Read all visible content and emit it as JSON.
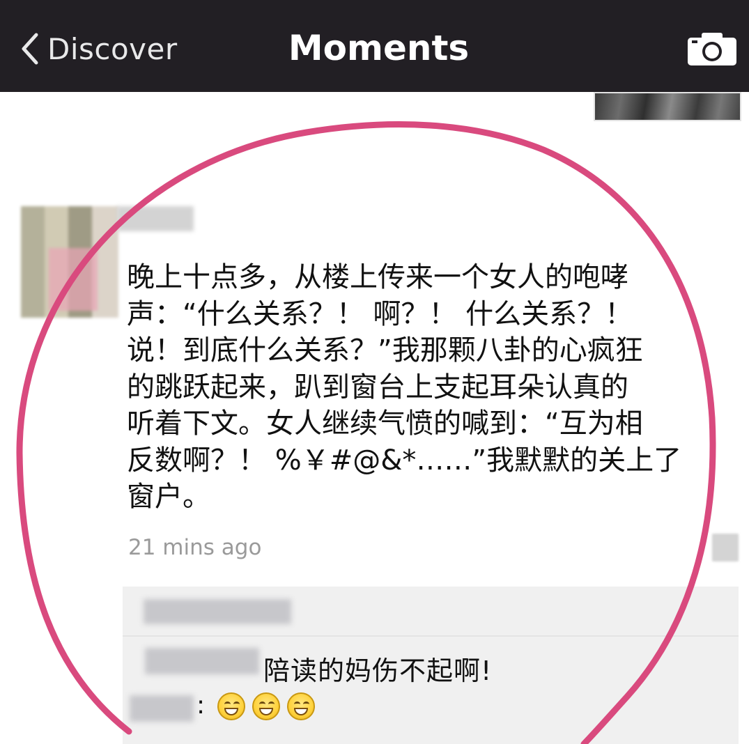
{
  "navbar": {
    "back_label": "Discover",
    "title": "Moments",
    "camera_icon": "camera-icon",
    "back_icon": "chevron-left-icon",
    "background": "#221f24"
  },
  "post": {
    "text": "晚上十点多，从楼上传来一个女人的咆哮\n声：“什么关系？！ 啊？！ 什么关系？！\n说！到底什么关系？”我那颗八卦的心疯狂\n的跳跃起来，趴到窗台上支起耳朵认真的\n听着下文。女人继续气愤的喊到：“互为相\n反数啊？！ %￥#@&*……”我默默的关上了\n窗户。",
    "time": "21 mins ago"
  },
  "comments": {
    "reply_text": "陪读的妈伤不起啊!",
    "colon": ":",
    "emojis": [
      "grin-emoji",
      "grin-emoji",
      "grin-emoji"
    ]
  },
  "colors": {
    "highlight_ring": "#d94a7e",
    "comment_background": "#f0f0f0",
    "timestamp": "#9a9a9a"
  }
}
